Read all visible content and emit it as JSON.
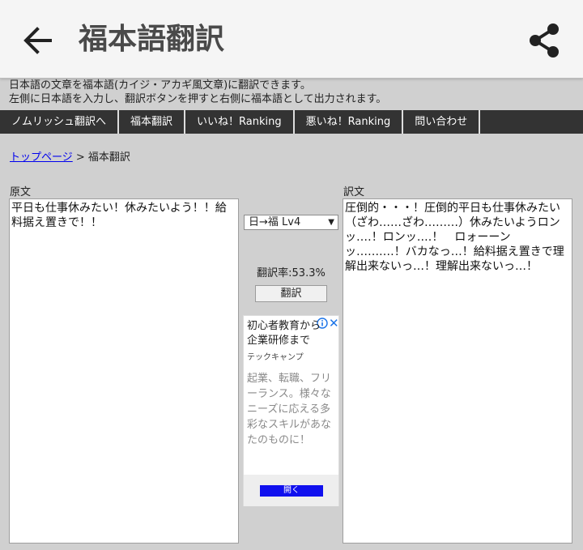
{
  "appbar": {
    "title": "福本語翻訳",
    "back_icon": "arrow-left-icon",
    "share_icon": "share-icon"
  },
  "description": {
    "line1": "日本語の文章を福本語(カイジ・アカギ風文章)に翻訳できます。",
    "line2": "左側に日本語を入力し、翻訳ボタンを押すと右側に福本語として出力されます。"
  },
  "nav": {
    "items": [
      {
        "label": "ノムリッシュ翻訳へ"
      },
      {
        "label": "福本翻訳"
      },
      {
        "label": "いいね！Ranking"
      },
      {
        "label": "悪いね！Ranking"
      },
      {
        "label": "問い合わせ"
      }
    ]
  },
  "breadcrumb": {
    "home": "トップページ",
    "separator": " > ",
    "current": "福本翻訳"
  },
  "translator": {
    "source_label": "原文",
    "source_text": "平日も仕事休みたい！休みたいよう！！給料据え置きで！！",
    "target_label": "訳文",
    "target_text": "圧倒的・・・！圧倒的平日も仕事休みたい（ざわ……ざわ………）休みたいようロンッ‥‥！ロンッ‥‥！　ロォーーンッ‥‥‥‥‥！バカなっ…！給料据え置きで理解出来ないっ…！理解出来ないっ…！",
    "mode_selected": "日→福 Lv4",
    "rate": "翻訳率:53.3%",
    "button_label": "翻訳"
  },
  "ad": {
    "headline": "初心者教育から企業研修まで",
    "advertiser": "テックキャンプ",
    "body": "起業、転職、フリーランス。様々なニーズに応える多彩なスキルがあなたのものに！",
    "cta": "開く",
    "close_glyph": "✕",
    "info_icon": "info-icon",
    "accent": "#1010ee"
  },
  "colors": {
    "appbar_bg": "#f5f5f5",
    "nav_bg": "#333333",
    "page_bg": "#d0d0d0",
    "link": "#0000ee"
  }
}
